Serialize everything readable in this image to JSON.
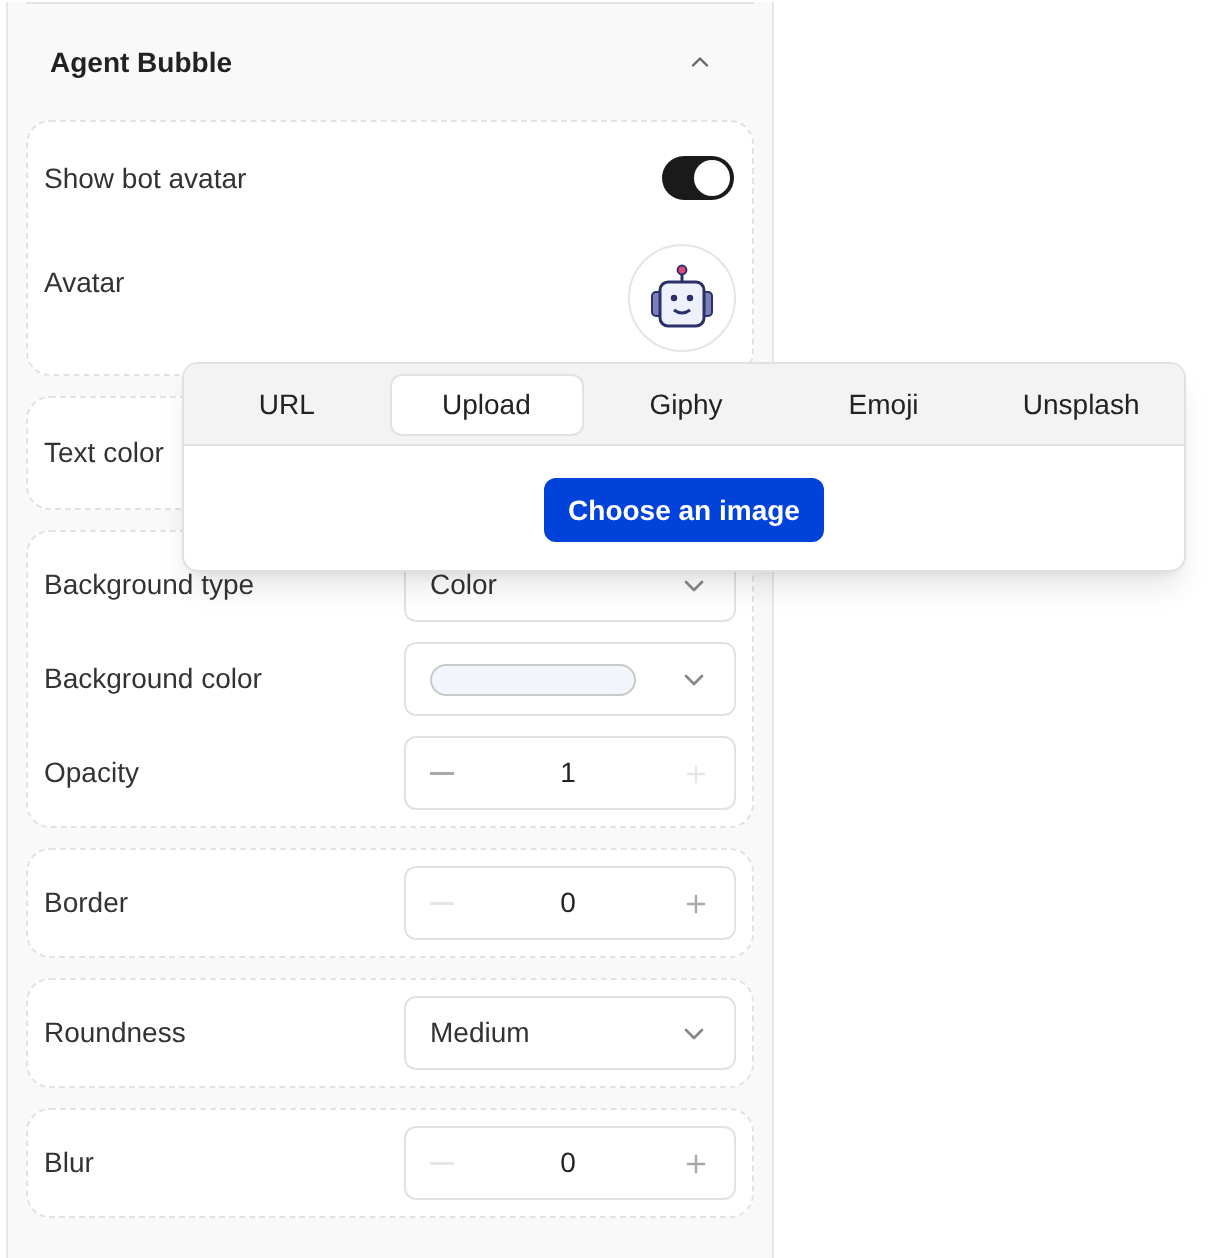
{
  "section": {
    "title": "Agent Bubble",
    "expanded": true
  },
  "cards": [
    {
      "rows": [
        {
          "kind": "toggle",
          "label": "Show bot avatar",
          "on": true
        },
        {
          "kind": "avatar",
          "label": "Avatar"
        }
      ]
    },
    {
      "rows": [
        {
          "kind": "label",
          "label": "Text color"
        }
      ]
    },
    {
      "rows": [
        {
          "kind": "select",
          "label": "Background type",
          "value": "Color"
        },
        {
          "kind": "color",
          "label": "Background color",
          "color": "#f3f5fd"
        },
        {
          "kind": "stepper",
          "label": "Opacity",
          "value": "1",
          "decrement_disabled": false,
          "increment_disabled": true
        }
      ]
    },
    {
      "rows": [
        {
          "kind": "stepper",
          "label": "Border",
          "value": "0",
          "decrement_disabled": true,
          "increment_disabled": false
        }
      ]
    },
    {
      "rows": [
        {
          "kind": "select",
          "label": "Roundness",
          "value": "Medium"
        }
      ]
    },
    {
      "rows": [
        {
          "kind": "stepper",
          "label": "Blur",
          "value": "0",
          "decrement_disabled": true,
          "increment_disabled": false
        }
      ]
    }
  ],
  "popover": {
    "tabs": [
      {
        "label": "URL",
        "selected": false
      },
      {
        "label": "Upload",
        "selected": true
      },
      {
        "label": "Giphy",
        "selected": false
      },
      {
        "label": "Emoji",
        "selected": false
      },
      {
        "label": "Unsplash",
        "selected": false
      }
    ],
    "button": "Choose an image"
  }
}
